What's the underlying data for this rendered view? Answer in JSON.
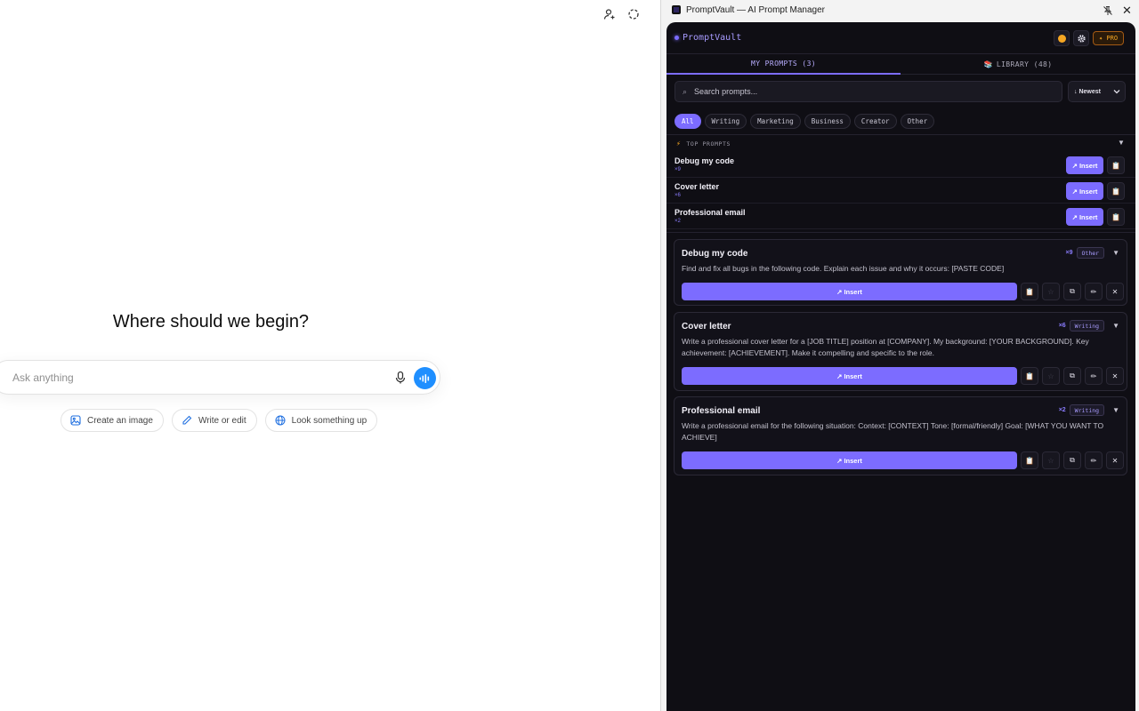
{
  "chat": {
    "hero_title": "Where should we begin?",
    "composer_placeholder": "Ask anything",
    "suggestions": [
      {
        "label": "Create an image",
        "icon": "image-icon"
      },
      {
        "label": "Write or edit",
        "icon": "pencil-icon"
      },
      {
        "label": "Look something up",
        "icon": "globe-icon"
      }
    ],
    "top_icons": [
      "add-person-icon",
      "dashed-circle-icon"
    ]
  },
  "panel": {
    "window_title": "PromptVault — AI Prompt Manager",
    "brand": "PromptVault",
    "pro_label": "✦ PRO",
    "header_icons": [
      "theme-icon",
      "gear-icon"
    ],
    "tabs": {
      "my_prompts": "MY PROMPTS (3)",
      "library_icon": "📚",
      "library": "LIBRARY (48)"
    },
    "search_placeholder": "Search prompts...",
    "sort_value": "↓ Newest",
    "filters": [
      "All",
      "Writing",
      "Marketing",
      "Business",
      "Creator",
      "Other"
    ],
    "active_filter": "All",
    "top_prompts_label": "TOP PROMPTS",
    "insert_label": "↗ Insert",
    "top_prompts": [
      {
        "title": "Debug my code",
        "count": "×9"
      },
      {
        "title": "Cover letter",
        "count": "×6"
      },
      {
        "title": "Professional email",
        "count": "×2"
      }
    ],
    "prompts": [
      {
        "title": "Debug my code",
        "count": "×9",
        "category": "Other",
        "body": "Find and fix all bugs in the following code. Explain each issue and why it occurs: [PASTE CODE]"
      },
      {
        "title": "Cover letter",
        "count": "×6",
        "category": "Writing",
        "body": "Write a professional cover letter for a [JOB TITLE] position at [COMPANY]. My background: [YOUR BACKGROUND]. Key achievement: [ACHIEVEMENT]. Make it compelling and specific to the role."
      },
      {
        "title": "Professional email",
        "count": "×2",
        "category": "Writing",
        "body": "Write a professional email for the following situation: Context: [CONTEXT] Tone: [formal/friendly] Goal: [WHAT YOU WANT TO ACHIEVE]"
      }
    ],
    "colors": {
      "accent": "#7c6cff",
      "panel_bg": "#0f0e14",
      "pro": "#f5a623"
    }
  }
}
